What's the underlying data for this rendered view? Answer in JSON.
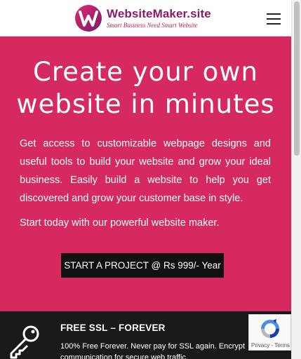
{
  "header": {
    "brand_name": "WebsiteMaker.site",
    "brand_tagline": "Smart Business Need Smart Website",
    "menu_icon": "hamburger-menu-icon"
  },
  "hero": {
    "title_line1": "Create your own",
    "title_line2": "website in minutes",
    "description": "Get access to customizable webpage designs and useful tools to build your website and grow your ideal business. Easily build a website to help you get discovered and grow your customer base in style.",
    "cta_text": "Start today with our powerful website maker.",
    "button_label": "START A PROJECT @ Rs 999/- Year"
  },
  "feature": {
    "icon": "key-icon",
    "title": "FREE SSL – FOREVER",
    "description": "100% Free Forever. Never pay for SSL again. Encrypt communication for secure web traffic."
  },
  "recaptcha": {
    "privacy_label": "Privacy",
    "separator": " - ",
    "terms_label": "Terms"
  },
  "colors": {
    "hero_background": "#d6295f",
    "brand_primary": "#8b1a6b",
    "brand_accent": "#c2185b",
    "button_background": "#111111",
    "feature_background": "#1a1a1a"
  }
}
